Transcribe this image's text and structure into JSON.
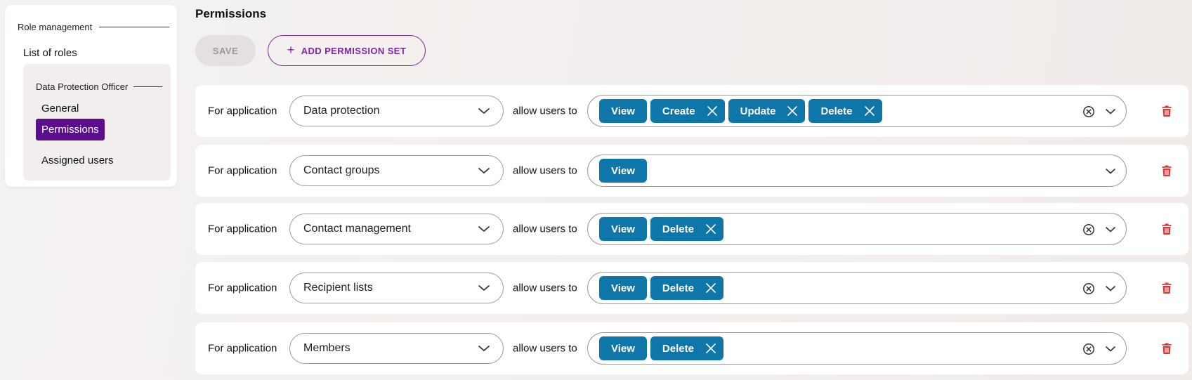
{
  "sidebar": {
    "section_title": "Role management",
    "list_roles_label": "List of roles",
    "role_title": "Data Protection Officer",
    "items": [
      {
        "label": "General",
        "active": false
      },
      {
        "label": "Permissions",
        "active": true
      },
      {
        "label": "Assigned users",
        "active": false
      }
    ]
  },
  "main": {
    "title": "Permissions",
    "save_label": "SAVE",
    "add_label": "ADD PERMISSION SET",
    "add_icon": "plus-icon"
  },
  "rows": [
    {
      "for_label": "For application",
      "application": "Data protection",
      "allow_label": "allow users to",
      "permissions": [
        {
          "label": "View",
          "removable": false
        },
        {
          "label": "Create",
          "removable": true
        },
        {
          "label": "Update",
          "removable": true
        },
        {
          "label": "Delete",
          "removable": true
        }
      ],
      "clearable": true
    },
    {
      "for_label": "For application",
      "application": "Contact groups",
      "allow_label": "allow users to",
      "permissions": [
        {
          "label": "View",
          "removable": false
        }
      ],
      "clearable": false
    },
    {
      "for_label": "For application",
      "application": "Contact management",
      "allow_label": "allow users to",
      "permissions": [
        {
          "label": "View",
          "removable": false
        },
        {
          "label": "Delete",
          "removable": true
        }
      ],
      "clearable": true
    },
    {
      "for_label": "For application",
      "application": "Recipient lists",
      "allow_label": "allow users to",
      "permissions": [
        {
          "label": "View",
          "removable": false
        },
        {
          "label": "Delete",
          "removable": true
        }
      ],
      "clearable": true
    },
    {
      "for_label": "For application",
      "application": "Members",
      "allow_label": "allow users to",
      "permissions": [
        {
          "label": "View",
          "removable": false
        },
        {
          "label": "Delete",
          "removable": true
        }
      ],
      "clearable": true
    }
  ],
  "colors": {
    "accent_purple": "#5b0e8c",
    "chip_blue": "#0e76a8",
    "delete_red": "#d93838"
  }
}
